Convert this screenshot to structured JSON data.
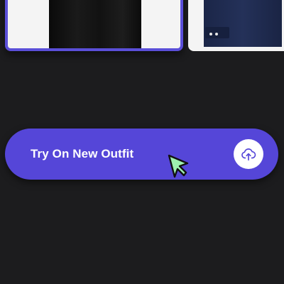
{
  "garments": [
    {
      "name": "black-garment",
      "selected": true
    },
    {
      "name": "navy-jacket",
      "selected": false
    }
  ],
  "action": {
    "label": "Try On New Outfit",
    "icon": "cloud-upload-icon"
  },
  "cursor": {
    "icon": "pointer-arrow-icon"
  },
  "colors": {
    "background": "#1c1c1e",
    "accent": "#5546d8",
    "selected_border": "#5b4fd9",
    "cursor_fill": "#9ef0b0"
  }
}
